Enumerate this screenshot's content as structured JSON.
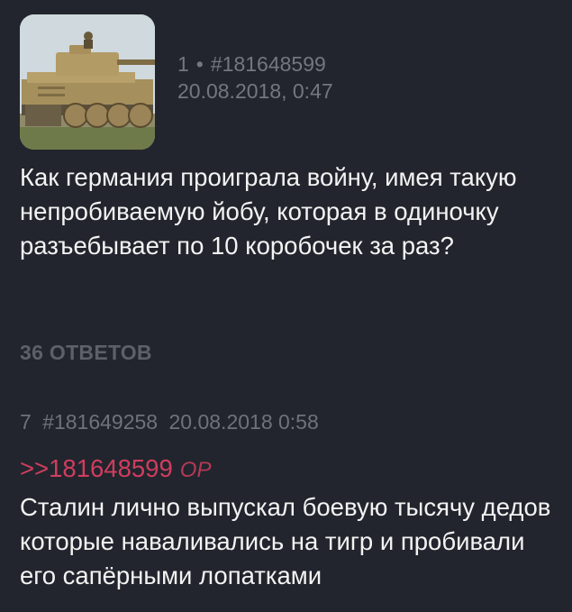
{
  "op": {
    "index": "1",
    "separator": "•",
    "post_number": "#181648599",
    "datetime": "20.08.2018, 0:47",
    "text": "Как германия проиграла войну, имея такую непробиваемую йобу, которая в одиночку разъебывает по 10 коробочек за раз?",
    "thumbnail_icon": "tiger-tank-photo"
  },
  "replies_label": "36 ОТВЕТОВ",
  "reply": {
    "index": "7",
    "post_number": "#181649258",
    "datetime": "20.08.2018 0:58",
    "quote_link": ">>181648599",
    "quote_op": "OP",
    "text": "Сталин лично выпускал боевую тысячу дедов которые наваливались на тигр и пробивали его сапёрными лопатками"
  },
  "colors": {
    "background": "#22252d",
    "meta_text": "#737780",
    "quote_link": "#d03d5f"
  }
}
